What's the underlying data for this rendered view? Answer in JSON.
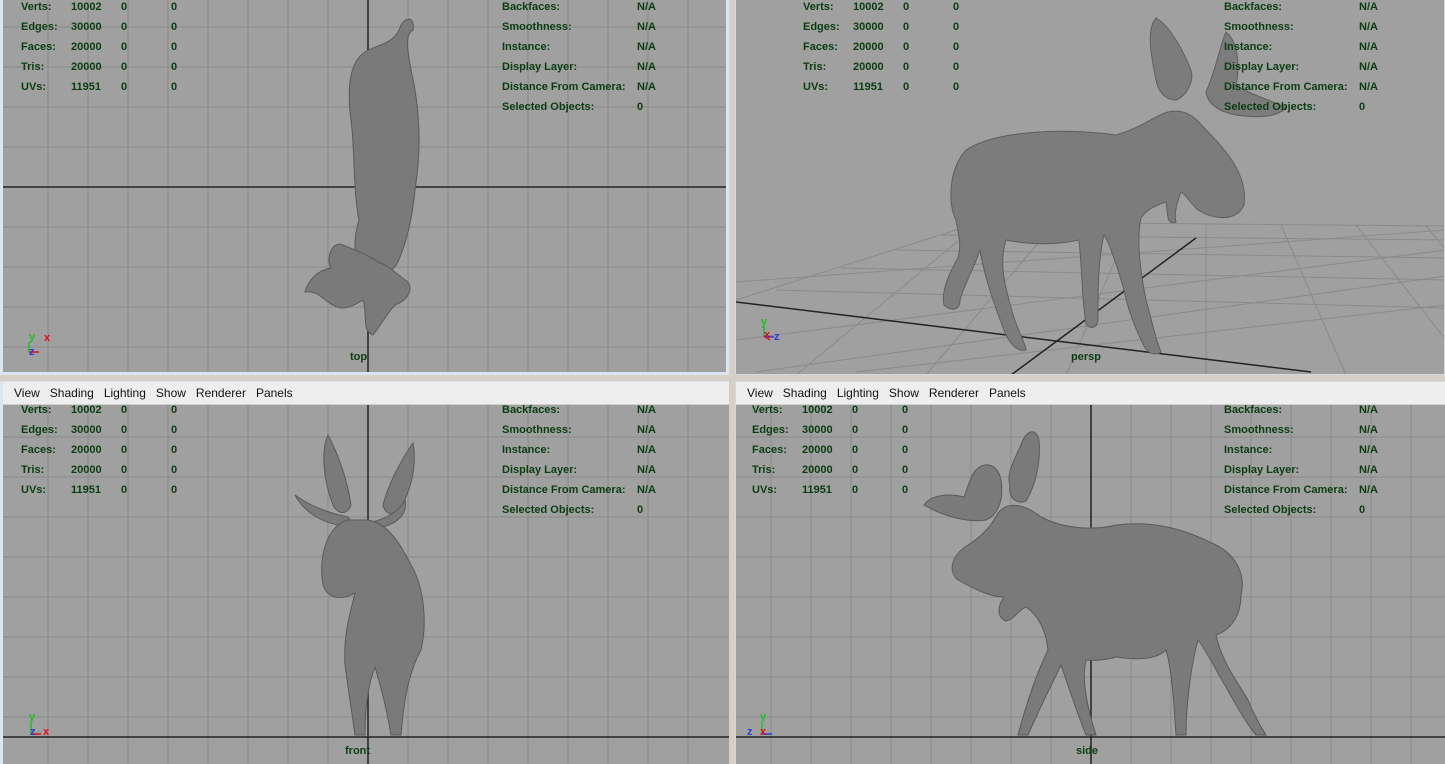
{
  "menu": [
    "View",
    "Shading",
    "Lighting",
    "Show",
    "Renderer",
    "Panels"
  ],
  "hud_left": [
    {
      "label": "Verts:",
      "v1": "10002",
      "v2": "0",
      "v3": "0"
    },
    {
      "label": "Edges:",
      "v1": "30000",
      "v2": "0",
      "v3": "0"
    },
    {
      "label": "Faces:",
      "v1": "20000",
      "v2": "0",
      "v3": "0"
    },
    {
      "label": "Tris:",
      "v1": "20000",
      "v2": "0",
      "v3": "0"
    },
    {
      "label": "UVs:",
      "v1": "11951",
      "v2": "0",
      "v3": "0"
    }
  ],
  "hud_right": [
    {
      "label": "Backfaces:",
      "value": "N/A"
    },
    {
      "label": "Smoothness:",
      "value": "N/A"
    },
    {
      "label": "Instance:",
      "value": "N/A"
    },
    {
      "label": "Display Layer:",
      "value": "N/A"
    },
    {
      "label": "Distance From Camera:",
      "value": "N/A"
    },
    {
      "label": "Selected Objects:",
      "value": "0"
    }
  ],
  "viewports": {
    "top": {
      "camera": "top",
      "axes": [
        "y",
        "x",
        "z"
      ]
    },
    "persp": {
      "camera": "persp",
      "axes": [
        "y",
        "x",
        "z"
      ]
    },
    "front": {
      "camera": "front",
      "axes": [
        "y",
        "z",
        "x"
      ]
    },
    "side": {
      "camera": "side",
      "axes": [
        "y",
        "z",
        "x"
      ]
    }
  },
  "colors": {
    "viewport_bg": "#a0a0a0",
    "grid_line": "#8a8a8a",
    "axis_line": "#222222",
    "hud_text": "#0b3d12",
    "axis_x": "#e0101a",
    "axis_y": "#1fbf27",
    "axis_z": "#2a3cd8",
    "model": "#7a7a7a"
  }
}
